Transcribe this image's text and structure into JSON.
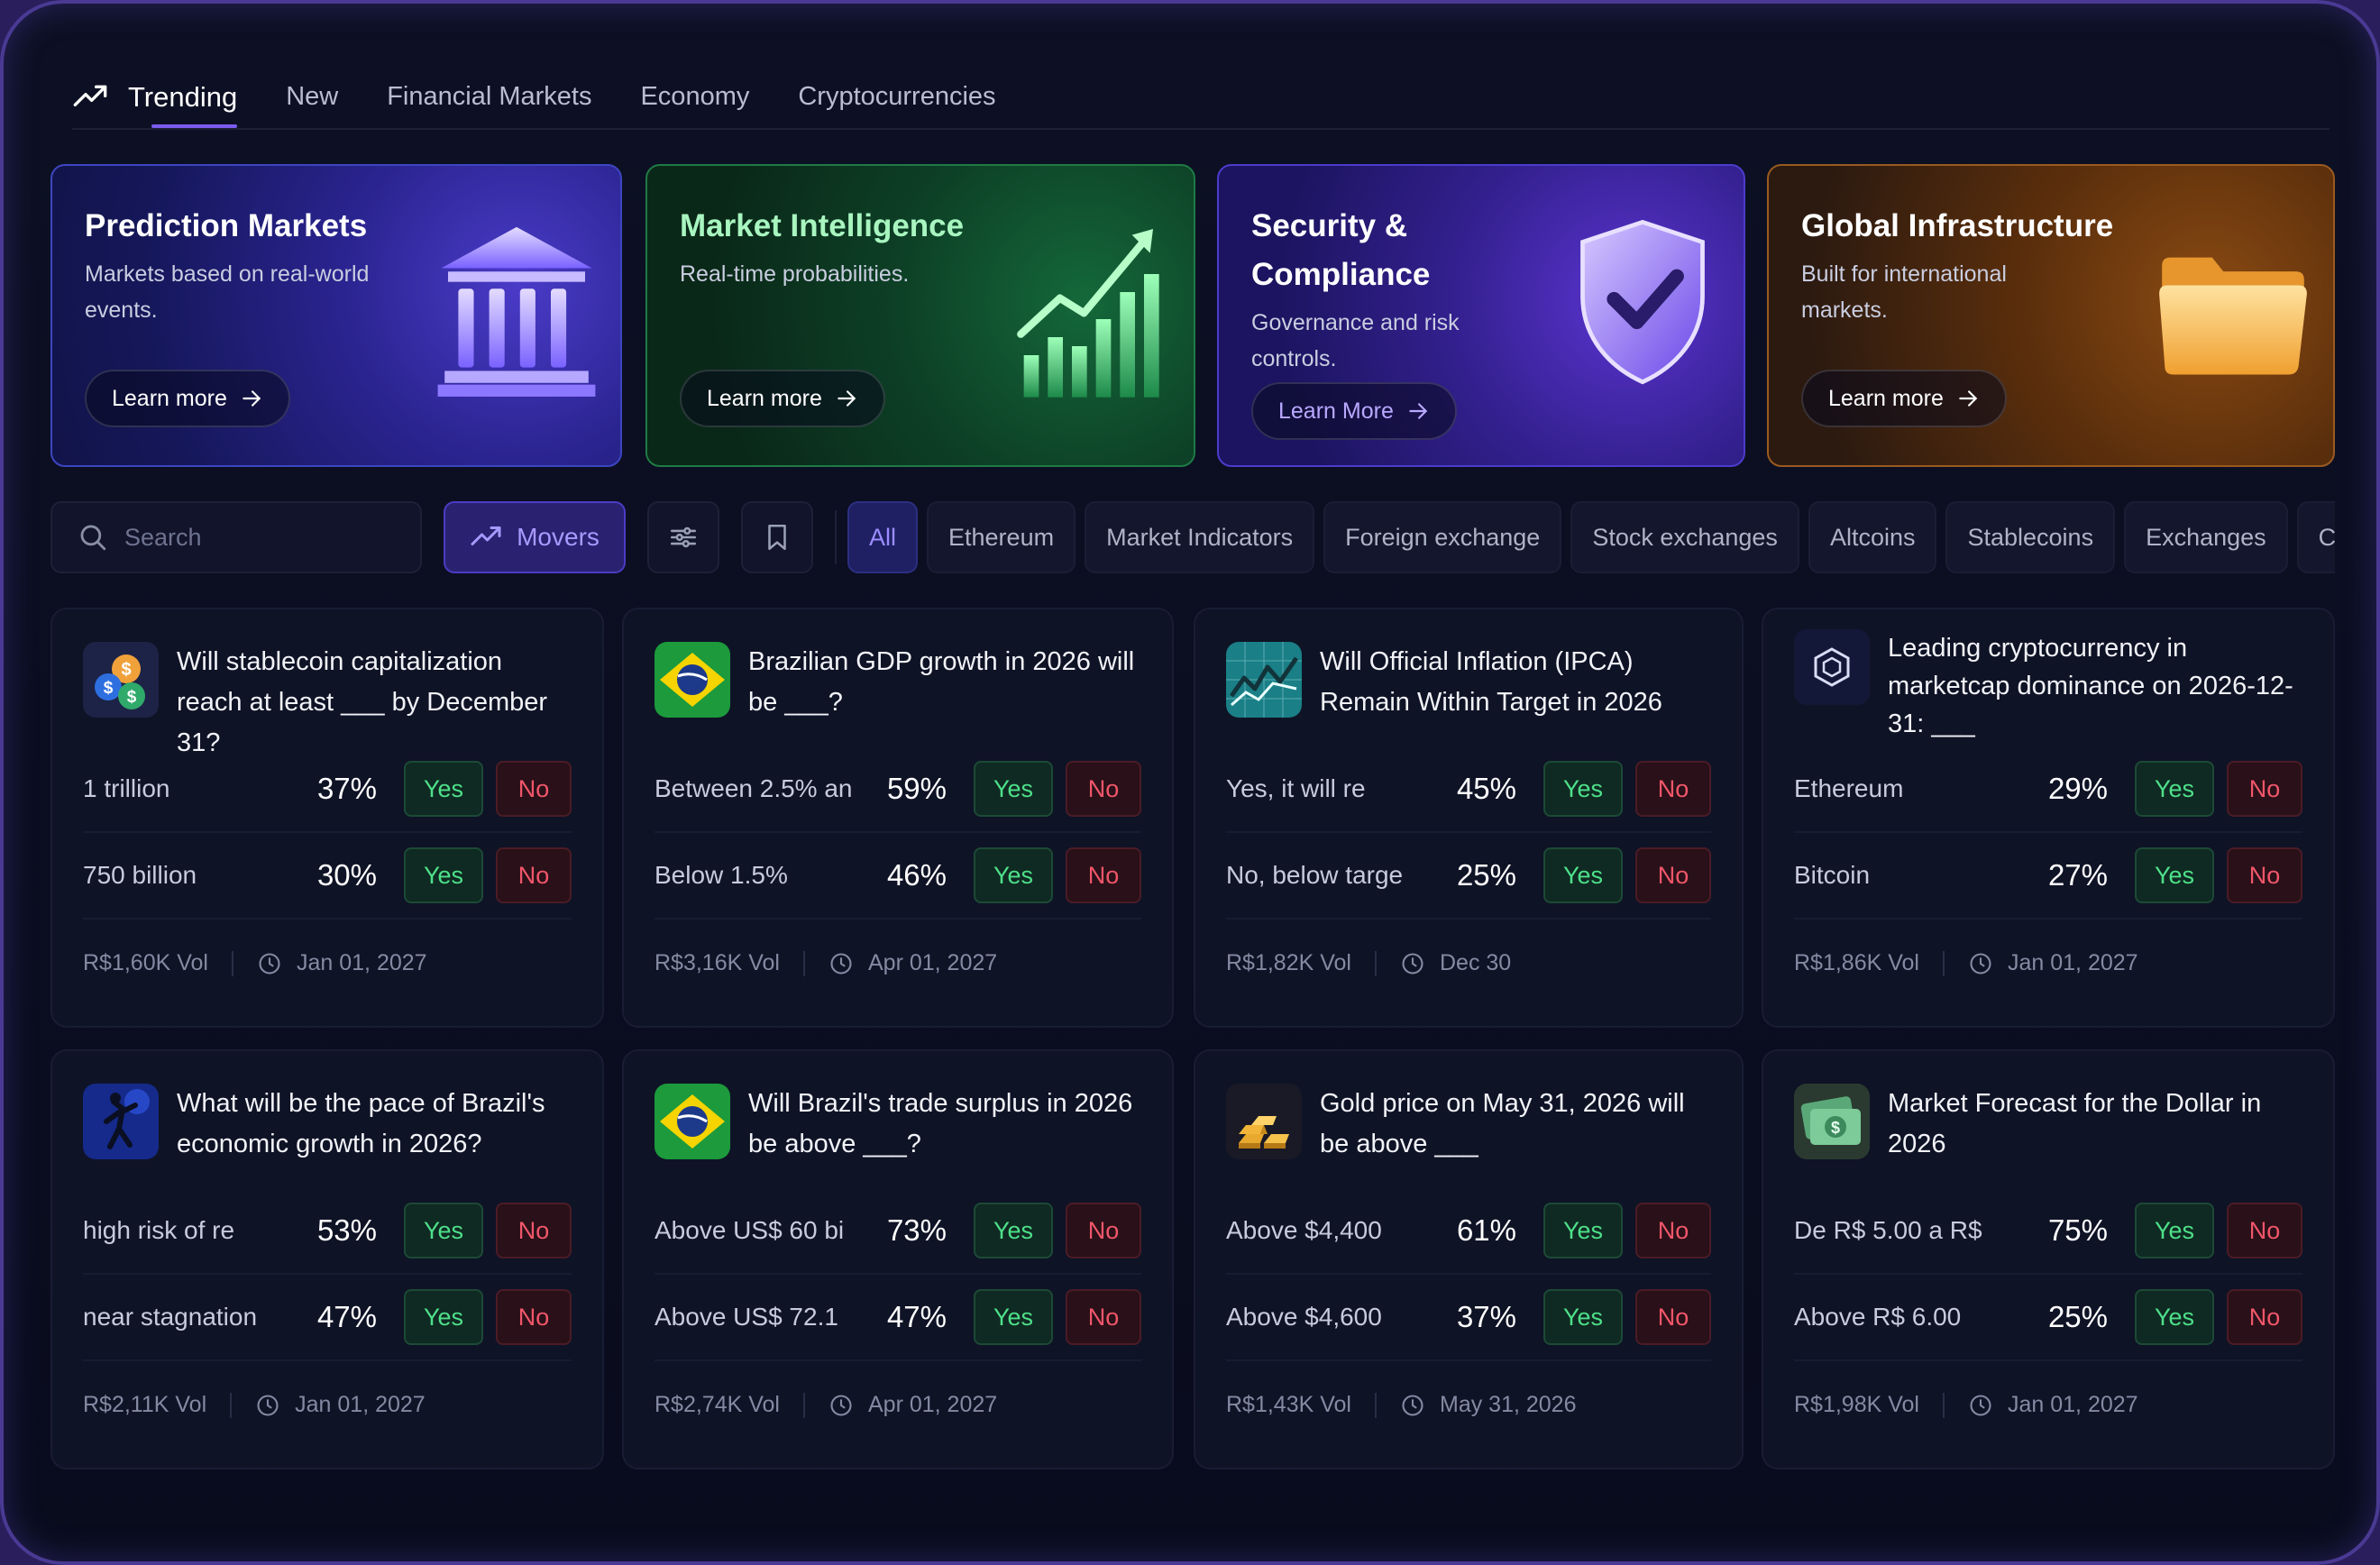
{
  "nav": {
    "tabs": [
      {
        "label": "Trending",
        "active": true
      },
      {
        "label": "New"
      },
      {
        "label": "Financial Markets"
      },
      {
        "label": "Economy"
      },
      {
        "label": "Cryptocurrencies"
      }
    ]
  },
  "heroes": [
    {
      "title": "Prediction Markets",
      "desc": "Markets based on real-world events.",
      "cta": "Learn more",
      "icon": "bank-icon"
    },
    {
      "title": "Market Intelligence",
      "desc": "Real-time probabilities.",
      "cta": "Learn more",
      "icon": "chart-growth-icon"
    },
    {
      "title": "Security & Compliance",
      "desc": "Governance and risk controls.",
      "cta": "Learn More",
      "icon": "shield-check-icon"
    },
    {
      "title": "Global Infrastructure",
      "desc": "Built for international markets.",
      "cta": "Learn more",
      "icon": "folder-icon"
    }
  ],
  "filters": {
    "search_placeholder": "Search",
    "movers_label": "Movers",
    "chips": [
      "All",
      "Ethereum",
      "Market Indicators",
      "Foreign exchange",
      "Stock exchanges",
      "Altcoins",
      "Stablecoins",
      "Exchanges",
      "Crypt"
    ]
  },
  "colors": {
    "accent": "#7b5cf0",
    "yes": "#4ee08a",
    "no": "#f0566a"
  },
  "markets": [
    {
      "question": "Will stablecoin capitalization reach at least ___ by December 31?",
      "thumb": "stablecoin-icon",
      "outcomes": [
        {
          "label": "1 trillion",
          "pct": "37%"
        },
        {
          "label": "750 billion",
          "pct": "30%"
        }
      ],
      "volume": "R$1,60K Vol",
      "date": "Jan 01, 2027"
    },
    {
      "question": "Brazilian GDP growth in 2026 will be ___?",
      "thumb": "brazil-flag-icon",
      "outcomes": [
        {
          "label": "Between 2.5% an",
          "pct": "59%"
        },
        {
          "label": "Below 1.5%",
          "pct": "46%"
        }
      ],
      "volume": "R$3,16K Vol",
      "date": "Apr 01, 2027"
    },
    {
      "question": "Will Official Inflation (IPCA) Remain Within Target in 2026",
      "thumb": "inflation-chart-icon",
      "outcomes": [
        {
          "label": "Yes, it will re",
          "pct": "45%"
        },
        {
          "label": "No, below targe",
          "pct": "25%"
        }
      ],
      "volume": "R$1,82K Vol",
      "date": "Dec 30"
    },
    {
      "question": "Leading cryptocurrency in marketcap dominance on 2026-12-31: ___",
      "thumb": "crypto-hexagon-icon",
      "outcomes": [
        {
          "label": "Ethereum",
          "pct": "29%"
        },
        {
          "label": "Bitcoin",
          "pct": "27%"
        }
      ],
      "volume": "R$1,86K Vol",
      "date": "Jan 01, 2027"
    },
    {
      "question": "What will be the pace of Brazil's economic growth in 2026?",
      "thumb": "economy-figure-icon",
      "outcomes": [
        {
          "label": "high risk of re",
          "pct": "53%"
        },
        {
          "label": "near stagnation",
          "pct": "47%"
        }
      ],
      "volume": "R$2,11K Vol",
      "date": "Jan 01, 2027"
    },
    {
      "question": "Will Brazil's trade surplus in 2026 be above ___?",
      "thumb": "brazil-flag-icon",
      "outcomes": [
        {
          "label": "Above US$ 60 bi",
          "pct": "73%"
        },
        {
          "label": "Above US$ 72.1",
          "pct": "47%"
        }
      ],
      "volume": "R$2,74K Vol",
      "date": "Apr 01, 2027"
    },
    {
      "question": "Gold price on May 31, 2026 will be above ___",
      "thumb": "gold-bars-icon",
      "outcomes": [
        {
          "label": "Above $4,400",
          "pct": "61%"
        },
        {
          "label": "Above $4,600",
          "pct": "37%"
        }
      ],
      "volume": "R$1,43K Vol",
      "date": "May 31, 2026"
    },
    {
      "question": "Market Forecast for the Dollar in 2026",
      "thumb": "dollar-bills-icon",
      "outcomes": [
        {
          "label": "De R$ 5.00 a R$",
          "pct": "75%"
        },
        {
          "label": "Above R$ 6.00",
          "pct": "25%"
        }
      ],
      "volume": "R$1,98K Vol",
      "date": "Jan 01, 2027"
    }
  ],
  "buttons": {
    "yes": "Yes",
    "no": "No"
  }
}
